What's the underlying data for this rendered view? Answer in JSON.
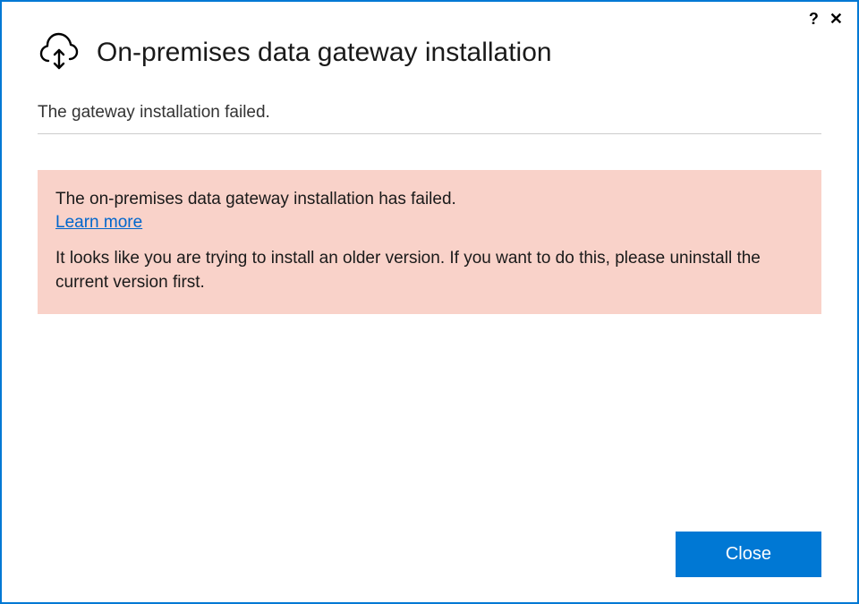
{
  "titlebar": {
    "help_tooltip": "Help",
    "close_tooltip": "Close"
  },
  "header": {
    "title": "On-premises data gateway installation"
  },
  "status": {
    "message": "The gateway installation failed."
  },
  "error_panel": {
    "title": "The on-premises data gateway installation has failed.",
    "learn_more_label": "Learn more",
    "detail": "It looks like you are trying to install an older version. If you want to do this, please uninstall the current version first."
  },
  "footer": {
    "close_label": "Close"
  },
  "colors": {
    "accent": "#0078d4",
    "error_bg": "#f9d2c9",
    "link": "#0066cc"
  }
}
